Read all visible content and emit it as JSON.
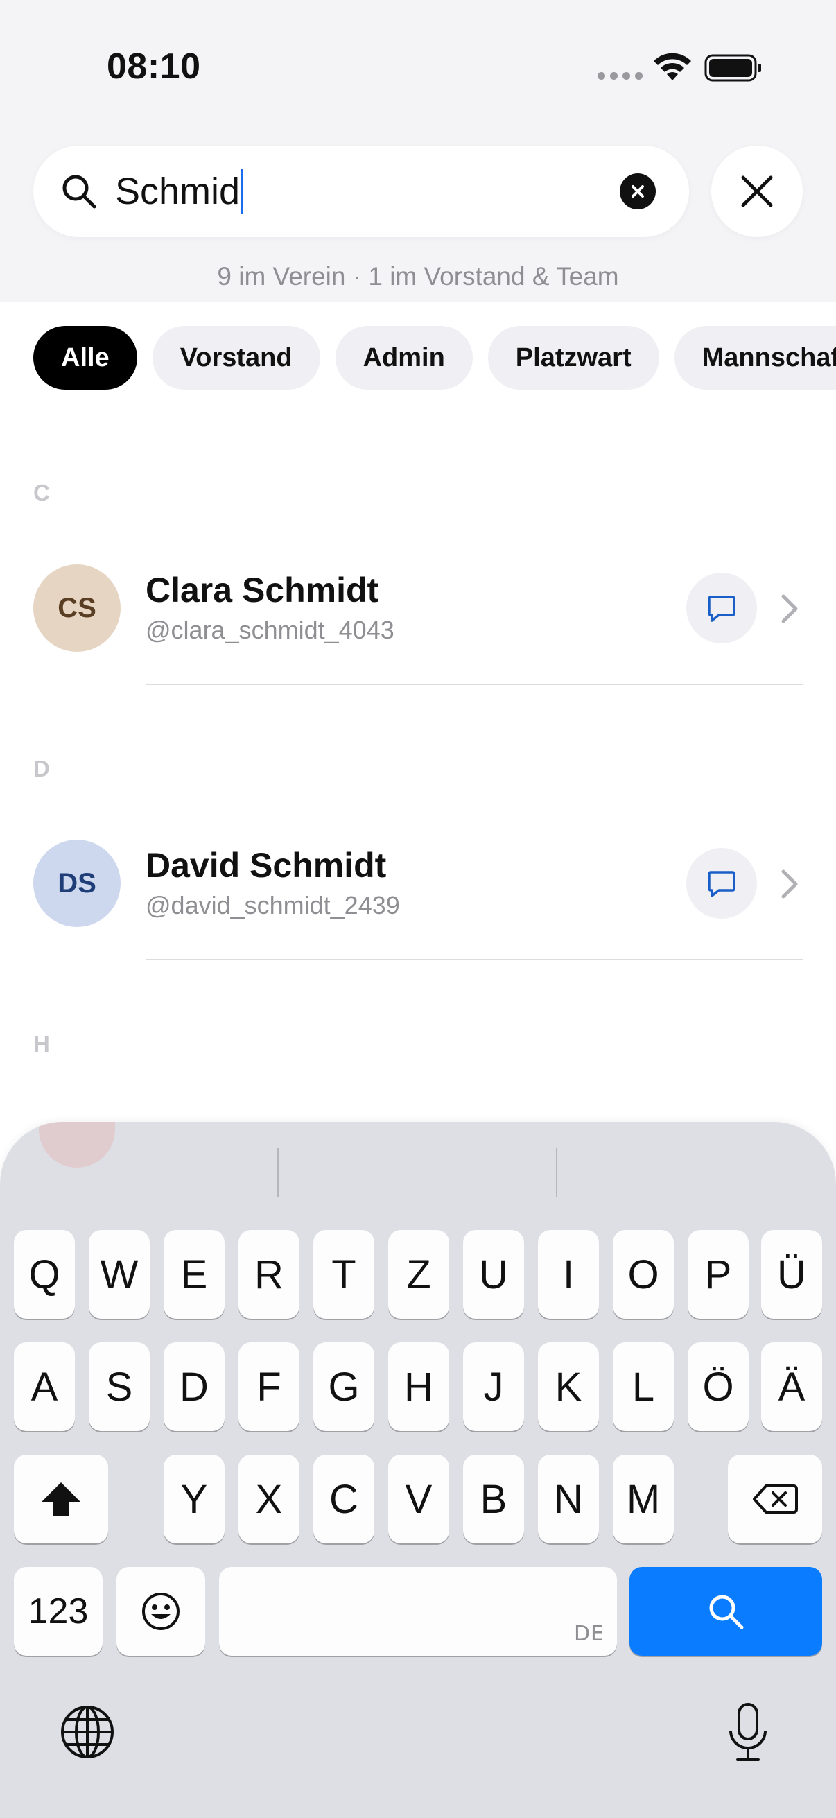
{
  "status": {
    "time": "08:10"
  },
  "search": {
    "query": "Schmid",
    "summary": "9 im Verein · 1 im Vorstand & Team"
  },
  "filters": [
    {
      "label": "Alle",
      "active": true
    },
    {
      "label": "Vorstand",
      "active": false
    },
    {
      "label": "Admin",
      "active": false
    },
    {
      "label": "Platzwart",
      "active": false
    },
    {
      "label": "Mannschaft",
      "active": false
    }
  ],
  "sections": [
    {
      "letter": "C",
      "members": [
        {
          "initials": "CS",
          "name": "Clara Schmidt",
          "handle": "@clara_schmidt_4043",
          "avatar_bg": "#e6d5c2",
          "avatar_fg": "#5a3e23"
        }
      ]
    },
    {
      "letter": "D",
      "members": [
        {
          "initials": "DS",
          "name": "David Schmidt",
          "handle": "@david_schmidt_2439",
          "avatar_bg": "#cdd8ef",
          "avatar_fg": "#1f3e78"
        }
      ]
    },
    {
      "letter": "H",
      "members": []
    }
  ],
  "keyboard": {
    "row1": [
      "Q",
      "W",
      "E",
      "R",
      "T",
      "Z",
      "U",
      "I",
      "O",
      "P",
      "Ü"
    ],
    "row2": [
      "A",
      "S",
      "D",
      "F",
      "G",
      "H",
      "J",
      "K",
      "L",
      "Ö",
      "Ä"
    ],
    "row3": [
      "Y",
      "X",
      "C",
      "V",
      "B",
      "N",
      "M"
    ],
    "numbers_label": "123",
    "language_tag": "DE"
  },
  "colors": {
    "accent": "#0a7cff",
    "active_chip": "#000000",
    "message_icon": "#1a5fc7"
  }
}
